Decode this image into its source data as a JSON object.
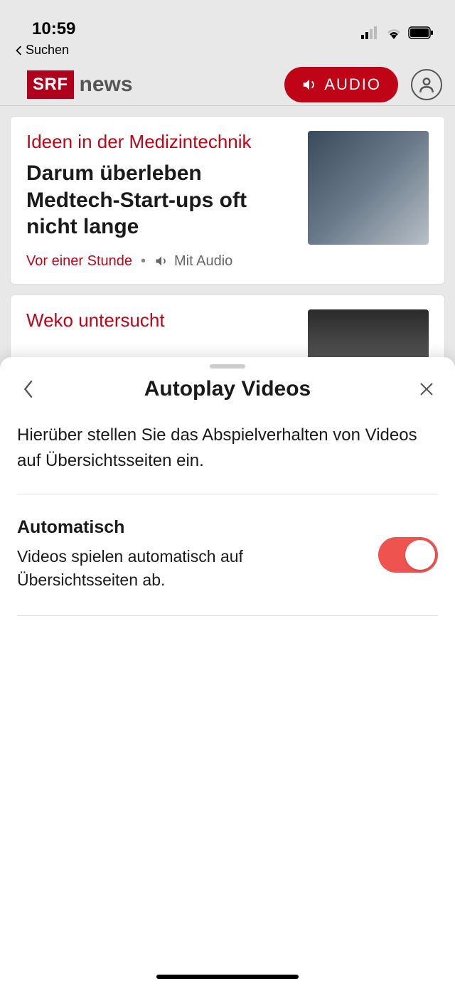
{
  "status": {
    "time": "10:59",
    "back_label": "Suchen"
  },
  "header": {
    "logo_box": "SRF",
    "logo_text": "news",
    "audio_button": "AUDIO"
  },
  "feed": [
    {
      "kicker": "Ideen in der Medizintechnik",
      "headline": "Darum überleben Medtech-Start-ups oft nicht lange",
      "time": "Vor einer Stunde",
      "audio_label": "Mit Audio"
    },
    {
      "kicker": "Weko untersucht"
    }
  ],
  "sheet": {
    "title": "Autoplay Videos",
    "description": "Hierüber stellen Sie das Abspielverhalten von Videos auf Übersichtsseiten ein.",
    "setting": {
      "label": "Automatisch",
      "sub": "Videos spielen automatisch auf Übersichtsseiten ab.",
      "on": true
    }
  }
}
